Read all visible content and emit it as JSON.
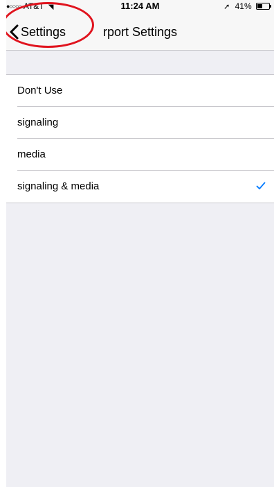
{
  "status_bar": {
    "carrier": "AT&T",
    "time": "11:24 AM",
    "battery_text": "41%",
    "battery_level": 0.41,
    "signal_icon": "signal-dots-icon",
    "wifi_icon": "wifi-icon",
    "location_icon": "location-arrow-icon",
    "battery_icon": "battery-icon"
  },
  "nav": {
    "back_label": "Settings",
    "title": "rport Settings",
    "back_icon": "chevron-left-icon"
  },
  "options": [
    {
      "label": "Don't Use",
      "selected": false
    },
    {
      "label": "signaling",
      "selected": false
    },
    {
      "label": "media",
      "selected": false
    },
    {
      "label": "signaling & media",
      "selected": true
    }
  ],
  "colors": {
    "accent": "#007aff",
    "annotation": "#e0141e",
    "grouped_background": "#efeff4",
    "separator": "#c8c7cc"
  }
}
